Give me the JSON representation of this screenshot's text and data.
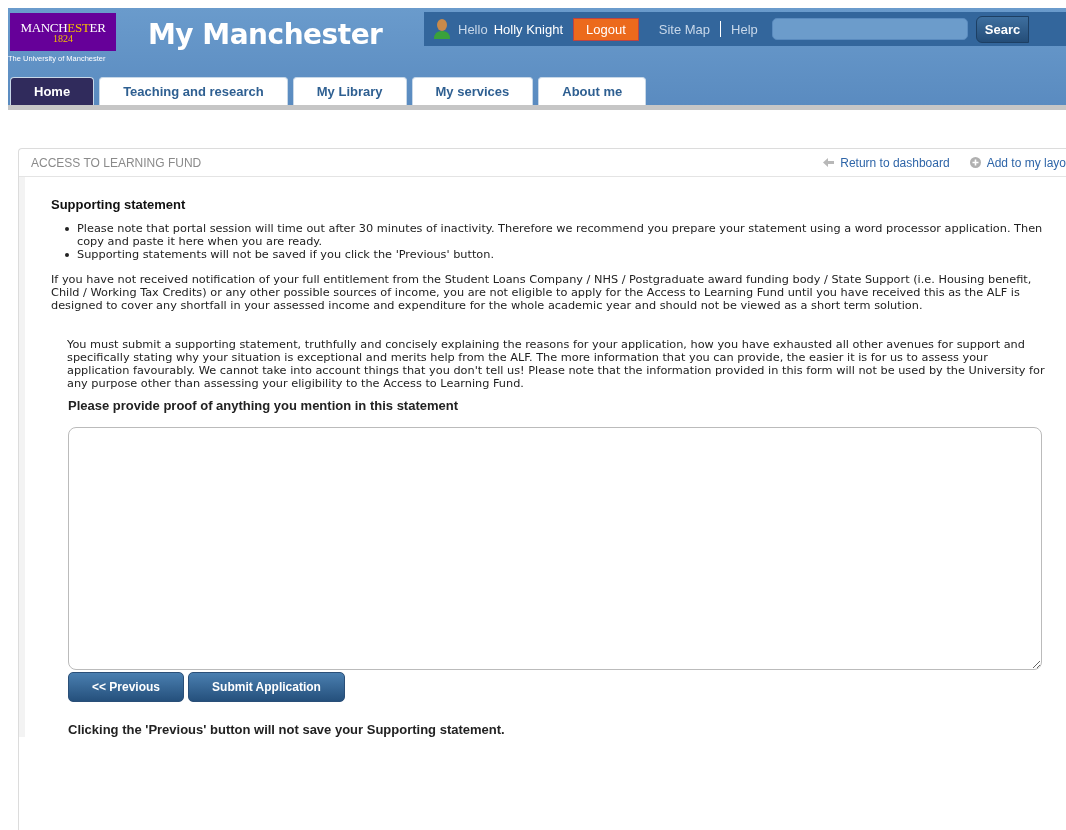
{
  "logo": {
    "segments": [
      {
        "text": "MANCH",
        "highlight": false
      },
      {
        "text": "EST",
        "highlight": true
      },
      {
        "text": "ER",
        "highlight": false
      }
    ],
    "year": "1824",
    "caption": "The University of Manchester"
  },
  "site_title": "My Manchester",
  "user_bar": {
    "greeting": "Hello",
    "user_name": "Holly Knight",
    "logout": "Logout",
    "links": [
      "Site Map",
      "Help"
    ],
    "search": {
      "button": "Searc"
    }
  },
  "tabs": [
    {
      "label": "Home",
      "selected": true
    },
    {
      "label": "Teaching and research",
      "selected": false
    },
    {
      "label": "My Library",
      "selected": false
    },
    {
      "label": "My services",
      "selected": false
    },
    {
      "label": "About me",
      "selected": false
    }
  ],
  "panel": {
    "title": "ACCESS TO LEARNING FUND",
    "actions": [
      {
        "kind": "back",
        "label": "Return to dashboard"
      },
      {
        "kind": "add",
        "label": "Add to my layo"
      }
    ]
  },
  "heading": "Supporting statement",
  "notes": [
    "Please note that portal session will time out after 30 minutes of inactivity. Therefore we recommend you prepare your statement using a word processor application. Then copy and paste it here when you are ready.",
    "Supporting statements will not be saved if you click the 'Previous' button."
  ],
  "eligibility_text": "If you have not received notification of your full entitlement from the Student Loans Company / NHS / Postgraduate award funding body / State Support (i.e. Housing benefit, Child / Working Tax Credits) or any other possible sources of income, you are not eligible to apply for the Access to Learning Fund until you have received this as the ALF is designed to cover any shortfall in your assessed income and expenditure for the whole academic year and should not be viewed as a short term solution.",
  "statement_text": "You must submit a supporting statement, truthfully and concisely explaining the reasons for your application, how you have exhausted all other avenues for support and specifically stating why your situation is exceptional and merits help from the ALF. The more information that you can provide, the easier it is for us to assess your application favourably. We cannot take into account things that you don't tell us! Please note that the information provided in this form will not be used by the University for any purpose other than assessing your eligibility to the Access to Learning Fund.",
  "proof_label": "Please provide proof of anything you mention in this statement",
  "buttons": [
    "<< Previous",
    "Submit Application"
  ],
  "warning": "Clicking the 'Previous' button will not save your Supporting statement."
}
